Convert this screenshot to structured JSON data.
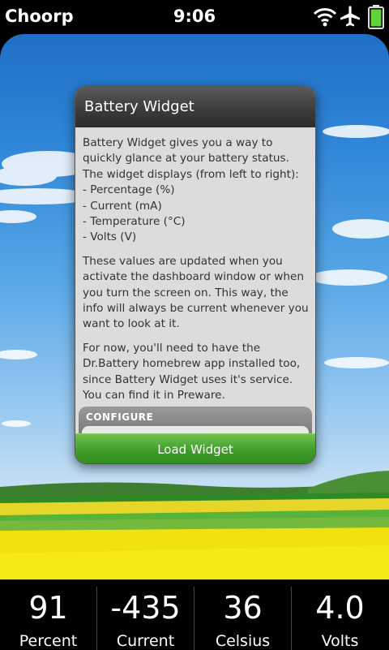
{
  "status_bar": {
    "carrier": "Choorp",
    "time": "9:06",
    "icons": [
      "wifi-icon",
      "airplane-icon",
      "battery-icon"
    ],
    "battery_level": 1.0
  },
  "dialog": {
    "title": "Battery Widget",
    "intro": "Battery Widget gives you a way to quickly glance at your battery status. The widget displays (from left to right):",
    "items": [
      "- Percentage (%)",
      "- Current (mA)",
      "- Temperature (°C)",
      "- Volts (V)"
    ],
    "para2": "These values are updated when you activate the dashboard window or when you turn the screen on. This way, the info will always be current whenever you want to look at it.",
    "para3": "For now, you'll need to have the Dr.Battery homebrew app installed too, since Battery Widget uses it's service. You can find it in Preware.",
    "configure_label": "CONFIGURE",
    "button_label": "Load Widget"
  },
  "dashboard": {
    "items": [
      {
        "value": "91",
        "label": "Percent"
      },
      {
        "value": "-435",
        "label": "Current"
      },
      {
        "value": "36",
        "label": "Celsius"
      },
      {
        "value": "4.0",
        "label": "Volts"
      }
    ]
  },
  "colors": {
    "accent_green": "#3f9c2a",
    "header_dark": "#3a3a3a",
    "battery_green": "#5fd33a"
  }
}
